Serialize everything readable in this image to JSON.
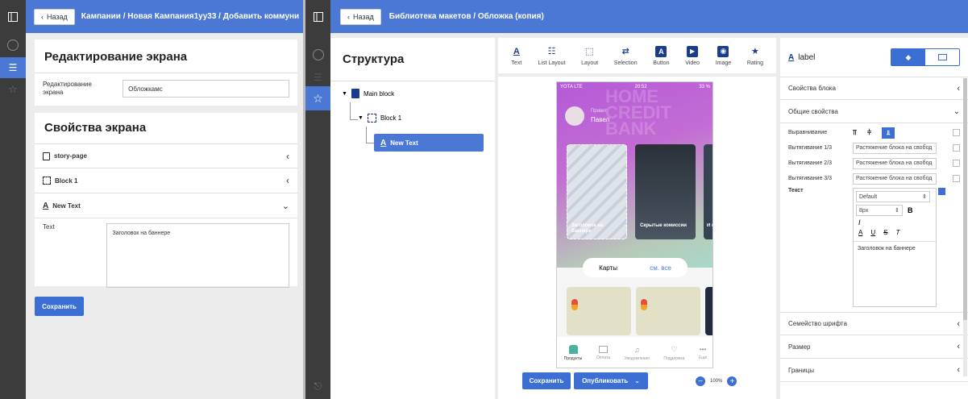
{
  "left": {
    "back_label": "Назад",
    "breadcrumb": "Кампании / Новая Кампания1уу33 / Добавить коммуникацию",
    "edit_title": "Редактирование экрана",
    "edit_label": "Редактирование экрана",
    "edit_value": "Обложкамс",
    "props_title": "Свойства экрана",
    "items": [
      {
        "label": "story-page",
        "chev": "‹"
      },
      {
        "label": "Block 1",
        "chev": "‹"
      },
      {
        "label": "New Text",
        "chev": "⌄"
      }
    ],
    "text_label": "Text",
    "text_value": "Заголовок на баннере",
    "save_label": "Сохранить"
  },
  "right": {
    "back_label": "Назад",
    "breadcrumb": "Библиотека макетов / Обложка (копия)",
    "structure_title": "Структура",
    "tree": [
      {
        "label": "Main block"
      },
      {
        "label": "Block 1"
      },
      {
        "label": "New Text"
      }
    ],
    "toolbar": [
      {
        "icon": "text-icon",
        "glyph": "A",
        "label": "Text"
      },
      {
        "icon": "list-layout-icon",
        "glyph": "☷",
        "label": "List Layout"
      },
      {
        "icon": "layout-icon",
        "glyph": "⬚",
        "label": "Layout"
      },
      {
        "icon": "selection-icon",
        "glyph": "⇄",
        "label": "Selection"
      },
      {
        "icon": "button-icon",
        "glyph": "A",
        "label": "Button"
      },
      {
        "icon": "video-icon",
        "glyph": "▶",
        "label": "Video"
      },
      {
        "icon": "image-icon",
        "glyph": "◉",
        "label": "Image"
      },
      {
        "icon": "rating-icon",
        "glyph": "★",
        "label": "Rating"
      }
    ],
    "phone": {
      "carrier": "YOTA LTE",
      "time": "20:52",
      "battery": "33 %",
      "greeting": "Привет",
      "name": "Павел",
      "card1": "Заголовок на баннере",
      "card2": "Скрытые комиссии",
      "card3": "И в",
      "cards_title": "Карты",
      "see_all": "см. все",
      "nav": [
        "Продукты",
        "Оплата",
        "Уведомления",
        "Поддержка",
        "Ещё"
      ]
    },
    "save_label": "Сохранить",
    "publish_label": "Опубликовать",
    "zoom": "100%",
    "props": {
      "element_label": "label",
      "block_props": "Свойства блока",
      "common_props": "Общие свойства",
      "align_label": "Выравнивание",
      "stretch1_label": "Вытягивание 1/3",
      "stretch2_label": "Вытягивание 2/3",
      "stretch3_label": "Вытягивание 3/3",
      "stretch_value": "Растяжение блока на свобод",
      "text_label": "Текст",
      "font_select": "Default",
      "size_select": "8px",
      "text_value": "Заголовок на баннере",
      "font_family": "Семейство шрифта",
      "size": "Размер",
      "borders": "Границы"
    }
  },
  "colors": {
    "accent": "#3b6fd3",
    "topbar": "#4a78d4",
    "sidebar": "#3c3c3c"
  }
}
